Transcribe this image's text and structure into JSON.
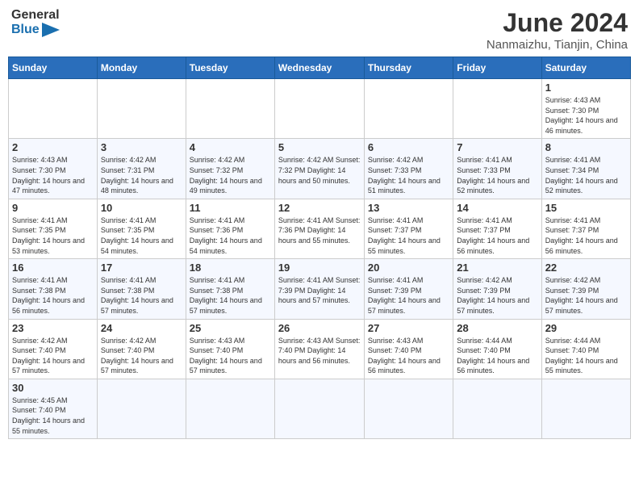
{
  "header": {
    "logo_general": "General",
    "logo_blue": "Blue",
    "title": "June 2024",
    "subtitle": "Nanmaizhu, Tianjin, China"
  },
  "weekdays": [
    "Sunday",
    "Monday",
    "Tuesday",
    "Wednesday",
    "Thursday",
    "Friday",
    "Saturday"
  ],
  "weeks": [
    [
      {
        "day": "",
        "info": ""
      },
      {
        "day": "",
        "info": ""
      },
      {
        "day": "",
        "info": ""
      },
      {
        "day": "",
        "info": ""
      },
      {
        "day": "",
        "info": ""
      },
      {
        "day": "",
        "info": ""
      },
      {
        "day": "1",
        "info": "Sunrise: 4:43 AM\nSunset: 7:30 PM\nDaylight: 14 hours and 46 minutes."
      }
    ],
    [
      {
        "day": "2",
        "info": "Sunrise: 4:43 AM\nSunset: 7:30 PM\nDaylight: 14 hours and 47 minutes."
      },
      {
        "day": "3",
        "info": "Sunrise: 4:42 AM\nSunset: 7:31 PM\nDaylight: 14 hours and 48 minutes."
      },
      {
        "day": "4",
        "info": "Sunrise: 4:42 AM\nSunset: 7:32 PM\nDaylight: 14 hours and 49 minutes."
      },
      {
        "day": "5",
        "info": "Sunrise: 4:42 AM\nSunset: 7:32 PM\nDaylight: 14 hours and 50 minutes."
      },
      {
        "day": "6",
        "info": "Sunrise: 4:42 AM\nSunset: 7:33 PM\nDaylight: 14 hours and 51 minutes."
      },
      {
        "day": "7",
        "info": "Sunrise: 4:41 AM\nSunset: 7:33 PM\nDaylight: 14 hours and 52 minutes."
      },
      {
        "day": "8",
        "info": "Sunrise: 4:41 AM\nSunset: 7:34 PM\nDaylight: 14 hours and 52 minutes."
      }
    ],
    [
      {
        "day": "9",
        "info": "Sunrise: 4:41 AM\nSunset: 7:35 PM\nDaylight: 14 hours and 53 minutes."
      },
      {
        "day": "10",
        "info": "Sunrise: 4:41 AM\nSunset: 7:35 PM\nDaylight: 14 hours and 54 minutes."
      },
      {
        "day": "11",
        "info": "Sunrise: 4:41 AM\nSunset: 7:36 PM\nDaylight: 14 hours and 54 minutes."
      },
      {
        "day": "12",
        "info": "Sunrise: 4:41 AM\nSunset: 7:36 PM\nDaylight: 14 hours and 55 minutes."
      },
      {
        "day": "13",
        "info": "Sunrise: 4:41 AM\nSunset: 7:37 PM\nDaylight: 14 hours and 55 minutes."
      },
      {
        "day": "14",
        "info": "Sunrise: 4:41 AM\nSunset: 7:37 PM\nDaylight: 14 hours and 56 minutes."
      },
      {
        "day": "15",
        "info": "Sunrise: 4:41 AM\nSunset: 7:37 PM\nDaylight: 14 hours and 56 minutes."
      }
    ],
    [
      {
        "day": "16",
        "info": "Sunrise: 4:41 AM\nSunset: 7:38 PM\nDaylight: 14 hours and 56 minutes."
      },
      {
        "day": "17",
        "info": "Sunrise: 4:41 AM\nSunset: 7:38 PM\nDaylight: 14 hours and 57 minutes."
      },
      {
        "day": "18",
        "info": "Sunrise: 4:41 AM\nSunset: 7:38 PM\nDaylight: 14 hours and 57 minutes."
      },
      {
        "day": "19",
        "info": "Sunrise: 4:41 AM\nSunset: 7:39 PM\nDaylight: 14 hours and 57 minutes."
      },
      {
        "day": "20",
        "info": "Sunrise: 4:41 AM\nSunset: 7:39 PM\nDaylight: 14 hours and 57 minutes."
      },
      {
        "day": "21",
        "info": "Sunrise: 4:42 AM\nSunset: 7:39 PM\nDaylight: 14 hours and 57 minutes."
      },
      {
        "day": "22",
        "info": "Sunrise: 4:42 AM\nSunset: 7:39 PM\nDaylight: 14 hours and 57 minutes."
      }
    ],
    [
      {
        "day": "23",
        "info": "Sunrise: 4:42 AM\nSunset: 7:40 PM\nDaylight: 14 hours and 57 minutes."
      },
      {
        "day": "24",
        "info": "Sunrise: 4:42 AM\nSunset: 7:40 PM\nDaylight: 14 hours and 57 minutes."
      },
      {
        "day": "25",
        "info": "Sunrise: 4:43 AM\nSunset: 7:40 PM\nDaylight: 14 hours and 57 minutes."
      },
      {
        "day": "26",
        "info": "Sunrise: 4:43 AM\nSunset: 7:40 PM\nDaylight: 14 hours and 56 minutes."
      },
      {
        "day": "27",
        "info": "Sunrise: 4:43 AM\nSunset: 7:40 PM\nDaylight: 14 hours and 56 minutes."
      },
      {
        "day": "28",
        "info": "Sunrise: 4:44 AM\nSunset: 7:40 PM\nDaylight: 14 hours and 56 minutes."
      },
      {
        "day": "29",
        "info": "Sunrise: 4:44 AM\nSunset: 7:40 PM\nDaylight: 14 hours and 55 minutes."
      }
    ],
    [
      {
        "day": "30",
        "info": "Sunrise: 4:45 AM\nSunset: 7:40 PM\nDaylight: 14 hours and 55 minutes."
      },
      {
        "day": "",
        "info": ""
      },
      {
        "day": "",
        "info": ""
      },
      {
        "day": "",
        "info": ""
      },
      {
        "day": "",
        "info": ""
      },
      {
        "day": "",
        "info": ""
      },
      {
        "day": "",
        "info": ""
      }
    ]
  ]
}
